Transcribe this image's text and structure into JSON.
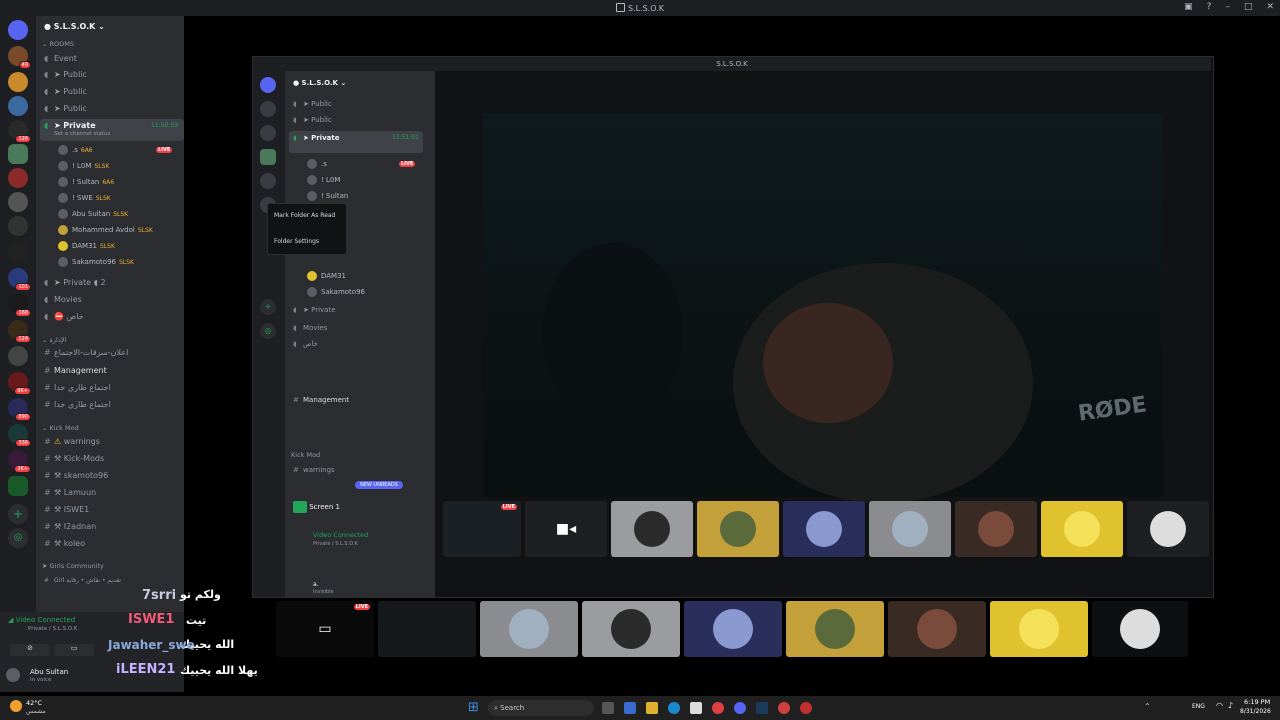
{
  "window": {
    "title": "S.L.S.O.K"
  },
  "server": {
    "name": "S.L.S.O.K"
  },
  "sidebar": {
    "rooms_label": "ROOMS",
    "channels": [
      {
        "name": "Event"
      },
      {
        "name": "Public"
      },
      {
        "name": "Public"
      },
      {
        "name": "Public"
      }
    ],
    "private_channel": {
      "name": "Private",
      "timer": "11:50:59",
      "status": "Set a channel status"
    },
    "voice_users": [
      {
        "name": ".s",
        "tag": "6A6",
        "live": "LIVE"
      },
      {
        "name": "! L0M",
        "tag": "SLSK"
      },
      {
        "name": "! Sultan",
        "tag": "6A6"
      },
      {
        "name": "! SWE",
        "tag": "SLSK"
      },
      {
        "name": "Abu Sultan",
        "tag": "SLSK"
      },
      {
        "name": "Mohammed Avdol",
        "tag": "SLSK"
      },
      {
        "name": "DAM31",
        "tag": "SLSK"
      },
      {
        "name": "Sakamoto96",
        "tag": "SLSK"
      }
    ],
    "private2": {
      "name": "Private",
      "count": "2"
    },
    "movies": "Movies",
    "special": "خاص",
    "admin_category": "الإدارة",
    "admin_channels": [
      "اعلان-سرقات-الاجتماع",
      "Management",
      "اجتماع طاري جدا",
      "اجتماع طاري جدا"
    ],
    "kick_category": "Kick Mod",
    "kick_channels": [
      "warnings",
      "Kick-Mods",
      "skamoto96",
      "Lamuun",
      "ISWE1",
      "I2adnan",
      "koleo"
    ],
    "girls_category": "Girls Community",
    "girls_note": "تقديم • نقاش • رقابة",
    "girls_channel": "Girl"
  },
  "voice_panel": {
    "status": "Video Connected",
    "channel": "Private / S.L.S.O.K",
    "user": "Abu Sultan",
    "user_status": "In voice"
  },
  "inner": {
    "title": "S.L.S.O.K",
    "context_menu": [
      "Mark Folder As Read",
      "Folder Settings"
    ],
    "timer": "11:51:01",
    "screen": "Screen 1",
    "vc_status": "Video Connected",
    "vc_channel": "Private / S.L.S.O.K",
    "user": "a.",
    "user_status": "Invisible",
    "new_unreads": "NEW UNREADS",
    "live": "LIVE"
  },
  "video": {
    "watermark": "RØDE"
  },
  "chat_overlay": [
    {
      "user": "7srri",
      "message": "ولكم تو"
    },
    {
      "user": "",
      "message": "تيت"
    },
    {
      "user": "ISWE1",
      "message": "الله يحييك"
    },
    {
      "user": "Jawaher_swe",
      "message": ""
    },
    {
      "user": "iLEEN21",
      "message": "يهلا الله يحييك"
    }
  ],
  "taskbar": {
    "weather_temp": "42°C",
    "weather_desc": "مشمس",
    "search": "Search",
    "lang": "ENG",
    "time": "6:19 PM",
    "date": "8/31/2026"
  },
  "colors": {
    "accent": "#5865f2",
    "live": "#f23f43",
    "online": "#23a55a",
    "tile_yellow": "#e0c22e"
  }
}
